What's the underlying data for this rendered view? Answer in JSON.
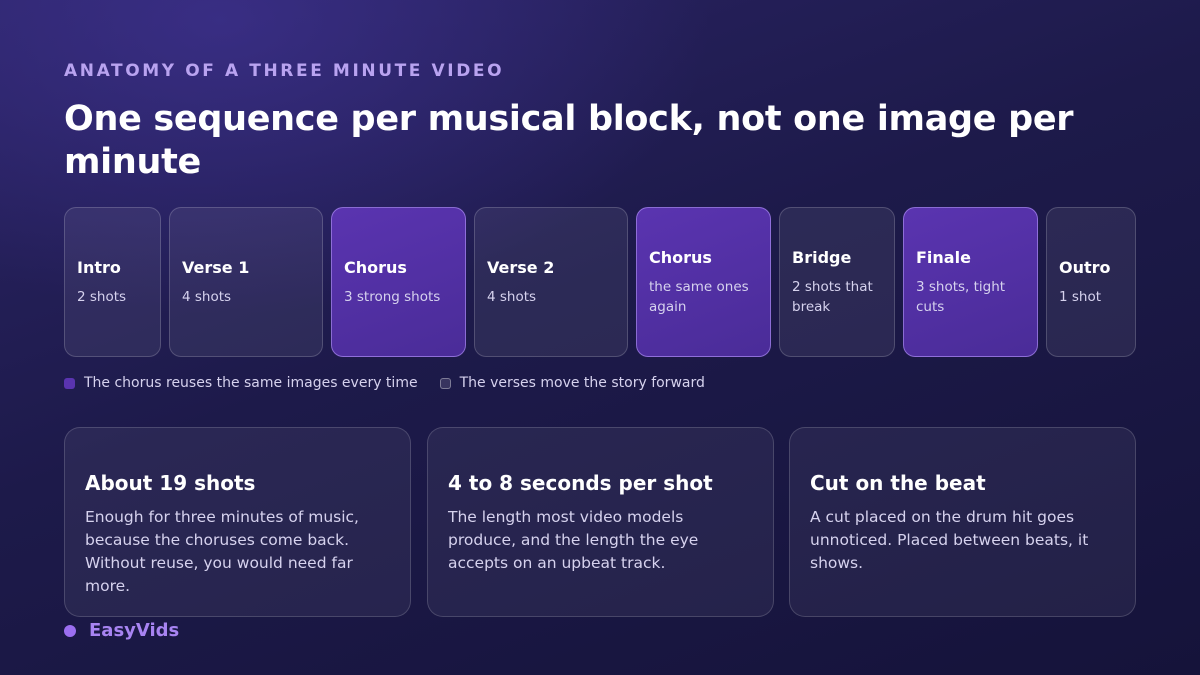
{
  "header": {
    "eyebrow": "ANATOMY OF A THREE MINUTE VIDEO",
    "title": "One sequence per musical block, not one image per minute"
  },
  "blocks": [
    {
      "name": "Intro",
      "desc": "2 shots",
      "kind": "verse"
    },
    {
      "name": "Verse 1",
      "desc": "4 shots",
      "kind": "verse"
    },
    {
      "name": "Chorus",
      "desc": "3 strong shots",
      "kind": "chorus"
    },
    {
      "name": "Verse 2",
      "desc": "4 shots",
      "kind": "verse"
    },
    {
      "name": "Chorus",
      "desc": "the same ones again",
      "kind": "chorus"
    },
    {
      "name": "Bridge",
      "desc": "2 shots that break",
      "kind": "verse"
    },
    {
      "name": "Finale",
      "desc": "3 shots, tight cuts",
      "kind": "chorus"
    },
    {
      "name": "Outro",
      "desc": "1 shot",
      "kind": "verse"
    }
  ],
  "legend": {
    "chorus": "The chorus reuses the same images every time",
    "verse": "The verses move the story forward"
  },
  "cards": [
    {
      "title": "About 19 shots",
      "body": "Enough for three minutes of music, because the choruses come back. Without reuse, you would need far more."
    },
    {
      "title": "4 to 8 seconds per shot",
      "body": "The length most video models produce, and the length the eye accepts on an upbeat track."
    },
    {
      "title": "Cut on the beat",
      "body": "A cut placed on the drum hit goes unnoticed. Placed between beats, it shows."
    }
  ],
  "brand": {
    "name": "EasyVids"
  },
  "colors": {
    "accent": "#5a34b0",
    "brand": "#a884f2"
  }
}
